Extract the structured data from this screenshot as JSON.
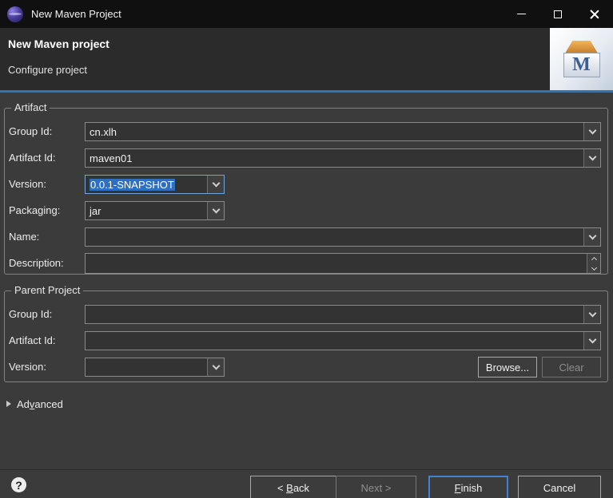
{
  "window": {
    "title": "New Maven Project"
  },
  "header": {
    "title": "New Maven project",
    "subtitle": "Configure project",
    "banner_letter": "M"
  },
  "artifact": {
    "group_label": "Artifact",
    "rows": [
      {
        "label": "Group Id:",
        "value": "cn.xlh"
      },
      {
        "label": "Artifact Id:",
        "value": "maven01"
      },
      {
        "label": "Version:",
        "value": "0.0.1-SNAPSHOT"
      },
      {
        "label": "Packaging:",
        "value": "jar"
      },
      {
        "label": "Name:",
        "value": ""
      },
      {
        "label": "Description:",
        "value": ""
      }
    ]
  },
  "parent": {
    "group_label": "Parent Project",
    "rows": [
      {
        "label": "Group Id:",
        "value": ""
      },
      {
        "label": "Artifact Id:",
        "value": ""
      },
      {
        "label": "Version:",
        "value": ""
      }
    ],
    "browse_label": "Browse...",
    "clear_label": "Clear"
  },
  "advanced": {
    "pre": "Ad",
    "mnemonic": "v",
    "post": "anced"
  },
  "footer": {
    "help": "?",
    "back": {
      "pre": "< ",
      "mnemonic": "B",
      "post": "ack"
    },
    "next_label": "Next >",
    "finish": {
      "mnemonic": "F",
      "post": "inish"
    },
    "cancel_label": "Cancel"
  },
  "icons": {
    "window_icon": "eclipse-sphere",
    "minimize_icon": "horizontal-line",
    "maximize_icon": "square-outline",
    "close_icon": "x-cross",
    "combo_arrow_icon": "chevron-down",
    "scroll_up_icon": "chevron-up",
    "scroll_down_icon": "chevron-down",
    "advanced_toggle_icon": "triangle-right",
    "help_icon": "question-mark",
    "maven_banner_icon": "maven-package-box"
  },
  "colors": {
    "titlebar_bg": "#101010",
    "header_bg": "#2b2b2b",
    "accent_line": "#2e75b6",
    "content_bg": "#3b3b3b",
    "selection_blue": "#2f6fc1",
    "finish_border": "#3f83d6"
  }
}
